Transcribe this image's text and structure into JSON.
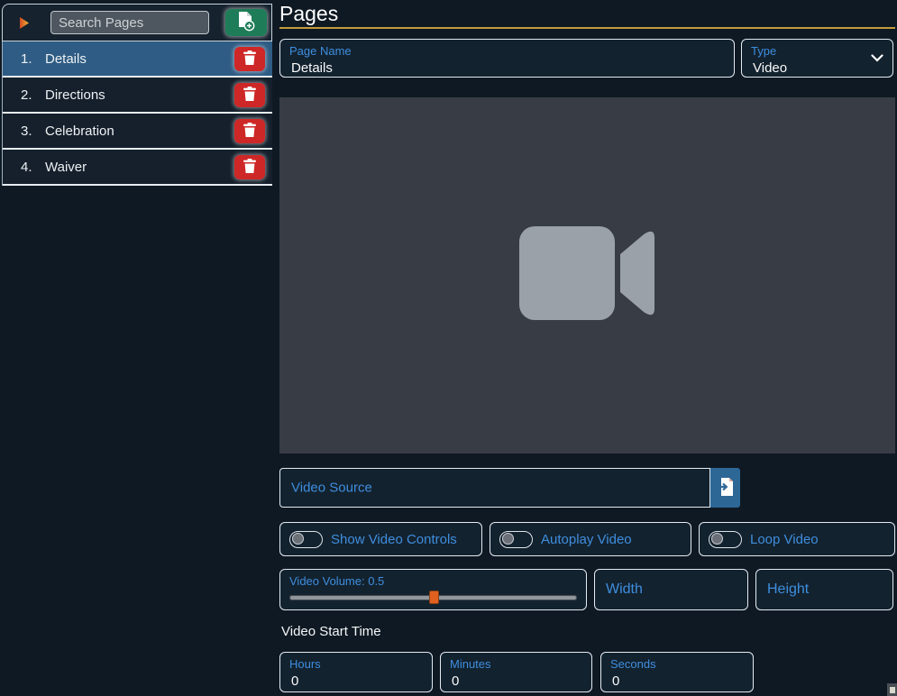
{
  "colors": {
    "background": "#0f1923",
    "box_background": "#13222f",
    "box_border": "#e4ebf2",
    "label_blue": "#3e8ede",
    "gold_accent": "#c49b3c",
    "selected_item_blue": "#2e5c84",
    "delete_red": "#ce2727",
    "add_green": "#1e7d58",
    "source_button_blue": "#2d6796",
    "slider_thumb_orange": "#e0611f",
    "video_placeholder_gray": "#383d45",
    "camera_icon_gray": "#9ba1a8"
  },
  "icons": {
    "sidebar_collapse": "play-arrow-icon",
    "add_page": "document-plus-icon",
    "delete_page": "trash-icon",
    "type_dropdown": "chevron-down-icon",
    "video_preview": "video-camera-icon",
    "video_source_browse": "file-import-icon"
  },
  "sidebar": {
    "search_placeholder": "Search Pages",
    "items": [
      {
        "number": "1.",
        "label": "Details"
      },
      {
        "number": "2.",
        "label": "Directions"
      },
      {
        "number": "3.",
        "label": "Celebration"
      },
      {
        "number": "4.",
        "label": "Waiver"
      }
    ]
  },
  "main": {
    "title": "Pages",
    "page_name": {
      "label": "Page Name",
      "value": "Details"
    },
    "type": {
      "label": "Type",
      "value": "Video"
    },
    "video_source": {
      "label": "Video Source",
      "value": ""
    },
    "toggles": [
      {
        "label": "Show Video Controls",
        "state": "off"
      },
      {
        "label": "Autoplay Video",
        "state": "off"
      },
      {
        "label": "Loop Video",
        "state": "off"
      }
    ],
    "volume": {
      "label": "Video Volume: 0.5",
      "value": 0.5
    },
    "width_field": {
      "label": "Width",
      "value": ""
    },
    "height_field": {
      "label": "Height",
      "value": ""
    },
    "start_time": {
      "heading": "Video Start Time",
      "hours": {
        "label": "Hours",
        "value": "0"
      },
      "minutes": {
        "label": "Minutes",
        "value": "0"
      },
      "seconds": {
        "label": "Seconds",
        "value": "0"
      }
    }
  }
}
